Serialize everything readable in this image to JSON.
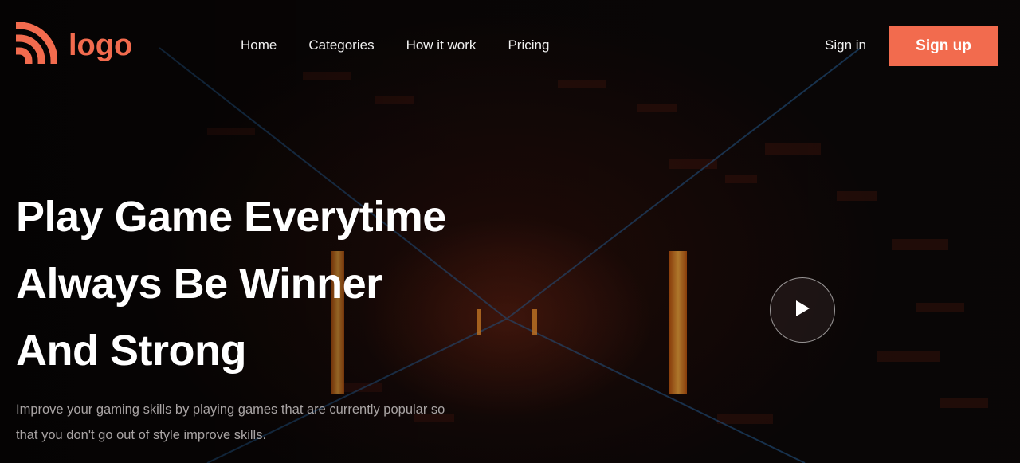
{
  "brand": {
    "logo_text": "logo",
    "accent": "#f26b4e"
  },
  "nav": {
    "items": [
      {
        "label": "Home"
      },
      {
        "label": "Categories"
      },
      {
        "label": "How it work"
      },
      {
        "label": "Pricing"
      }
    ],
    "signin_label": "Sign in",
    "signup_label": "Sign up"
  },
  "hero": {
    "headline_lines": [
      "Play Game Everytime",
      "Always Be Winner",
      "And Strong"
    ],
    "subtitle": "Improve your gaming skills by playing games that are currently popular so that you don't go out of style improve skills.",
    "play_icon": "play-icon"
  }
}
